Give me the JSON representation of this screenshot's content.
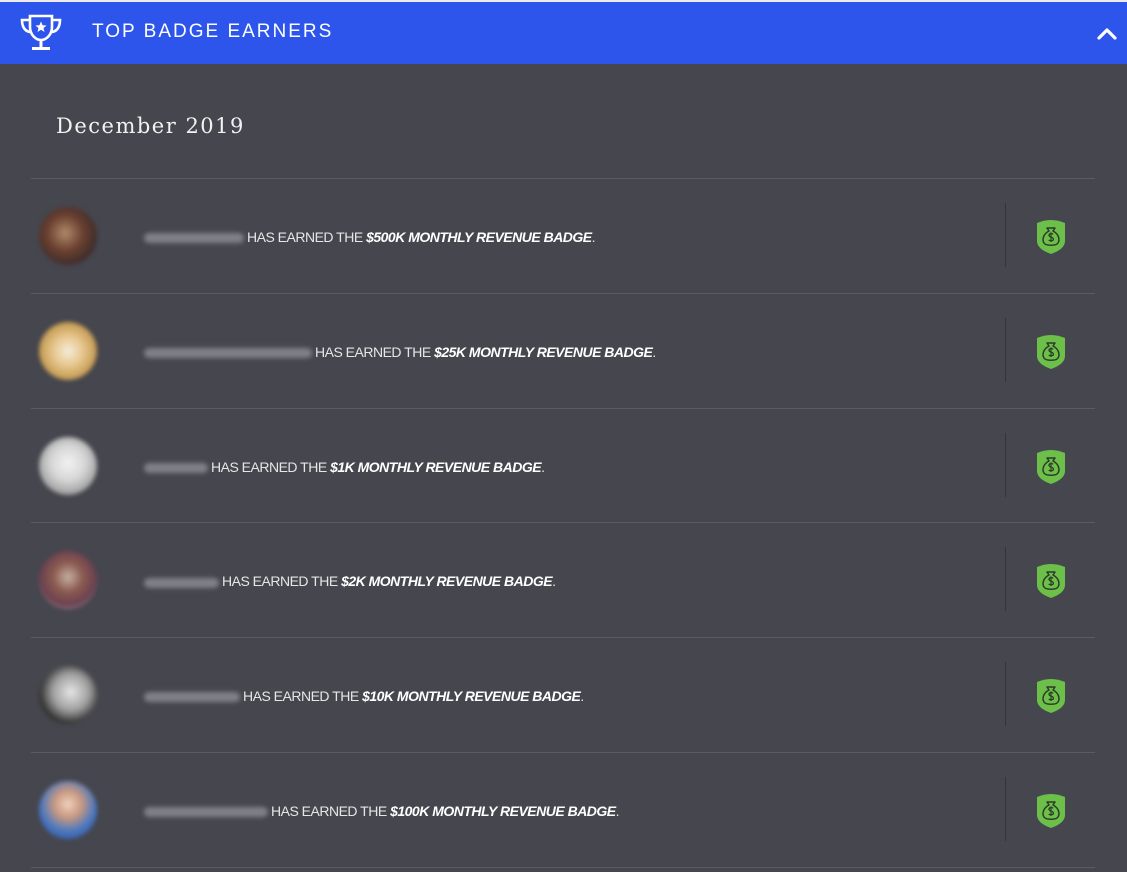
{
  "header": {
    "title": "TOP BADGE EARNERS",
    "color": "#2d55ec"
  },
  "section": {
    "month": "December 2019"
  },
  "icons": {
    "header_left": "trophy-icon",
    "header_right": "chevron-up-icon",
    "row_badge": "money-bag-shield-icon"
  },
  "earned_text": "HAS EARNED THE",
  "entries": [
    {
      "badge": "$500K MONTHLY REVENUE BADGE",
      "punct": "."
    },
    {
      "badge": "$25K MONTHLY REVENUE BADGE",
      "punct": "."
    },
    {
      "badge": "$1K MONTHLY REVENUE BADGE",
      "punct": "."
    },
    {
      "badge": "$2K MONTHLY REVENUE BADGE",
      "punct": "."
    },
    {
      "badge": "$10K MONTHLY REVENUE BADGE",
      "punct": "."
    },
    {
      "badge": "$100K MONTHLY REVENUE BADGE",
      "punct": "."
    }
  ],
  "badge_color": "#6cc04a"
}
